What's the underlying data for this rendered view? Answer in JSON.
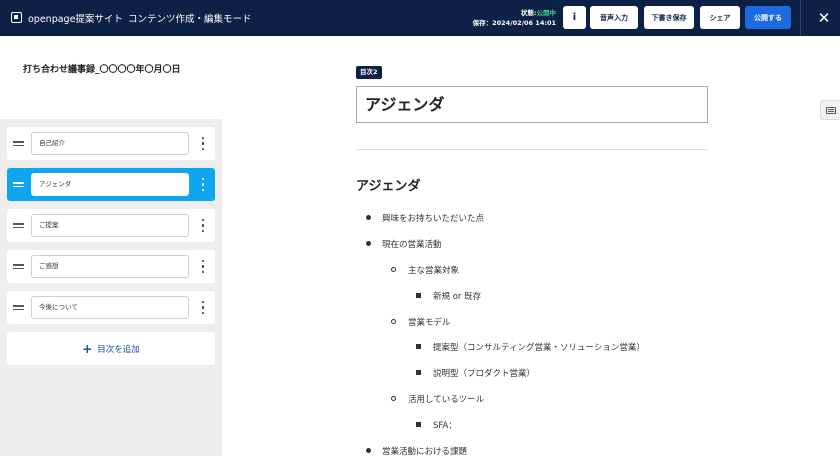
{
  "header": {
    "app_title": "openpage提案サイト",
    "mode": "コンテンツ作成・編集モード",
    "status_label": "状態:",
    "status_value": "公開中",
    "saved_label": "保存：2024/02/06 14:01",
    "info_label": "i",
    "voice_input": "音声入力",
    "save_draft": "下書き保存",
    "share": "シェア",
    "publish": "公開する",
    "close_icon": "close-icon",
    "colors": {
      "bar": "#0d2147",
      "publish": "#1e6be0",
      "status_value": "#3fd98a"
    }
  },
  "sidebar": {
    "doc_title": "打ち合わせ議事録_〇〇〇〇年〇月〇日",
    "items": [
      {
        "label": "自己紹介",
        "active": false
      },
      {
        "label": "アジェンダ",
        "active": true
      },
      {
        "label": "ご提案",
        "active": false
      },
      {
        "label": "ご感想",
        "active": false
      },
      {
        "label": "今後について",
        "active": false
      }
    ],
    "add_label": "目次を追加",
    "active_color": "#0ea5f1"
  },
  "main": {
    "section_badge": "目次2",
    "heading_value": "アジェンダ",
    "content_title": "アジェンダ",
    "bullets": [
      {
        "text": "興味をお持ちいただいた点",
        "level": 1
      },
      {
        "text": "現在の営業活動",
        "level": 1
      },
      {
        "text": "主な営業対象",
        "level": 2
      },
      {
        "text": "新規 or 既存",
        "level": 3
      },
      {
        "text": "営業モデル",
        "level": 2
      },
      {
        "text": "提案型（コンサルティング営業・ソリューション営業）",
        "level": 3
      },
      {
        "text": "説明型（プロダクト営業）",
        "level": 3
      },
      {
        "text": "活用しているツール",
        "level": 2
      },
      {
        "text": "SFA：",
        "level": 3
      },
      {
        "text": "営業活動における課題",
        "level": 1
      }
    ]
  }
}
